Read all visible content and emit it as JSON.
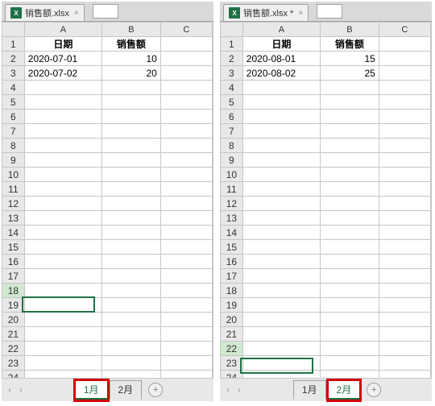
{
  "left": {
    "file_name": "销售额.xlsx",
    "name_box": "",
    "col_headers": [
      "A",
      "B",
      "C"
    ],
    "row_count": 24,
    "selected_row": 18,
    "data": {
      "r1": {
        "a": "日期",
        "b": "销售额"
      },
      "r2": {
        "a": "2020-07-01",
        "b": "10"
      },
      "r3": {
        "a": "2020-07-02",
        "b": "20"
      }
    },
    "sheet_tabs": [
      "1月",
      "2月"
    ],
    "active_tab": 0,
    "highlight_tab": 0
  },
  "right": {
    "file_name": "销售额.xlsx *",
    "name_box": "",
    "col_headers": [
      "A",
      "B",
      "C"
    ],
    "row_count": 24,
    "selected_row": 22,
    "data": {
      "r1": {
        "a": "日期",
        "b": "销售额"
      },
      "r2": {
        "a": "2020-08-01",
        "b": "15"
      },
      "r3": {
        "a": "2020-08-02",
        "b": "25"
      }
    },
    "sheet_tabs": [
      "1月",
      "2月"
    ],
    "active_tab": 1,
    "highlight_tab": 1
  },
  "icons": {
    "xls": "X",
    "close": "×",
    "prev": "‹",
    "next": "›",
    "add": "+"
  }
}
